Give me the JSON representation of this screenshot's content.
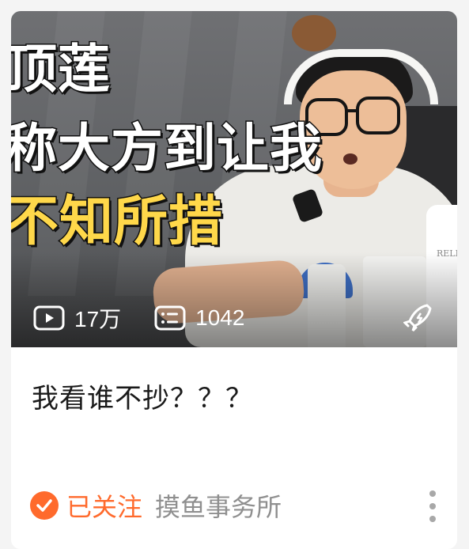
{
  "video_card": {
    "thumbnail": {
      "overlay_lines": [
        "顶莲",
        "称大方到让我",
        "不知所措"
      ],
      "overlay_colors": {
        "white_text": "#ffffff",
        "highlight_text": "#ffd84a"
      },
      "bottle_label": "RELL",
      "stats": {
        "play_icon": "play-icon",
        "play_count": "17万",
        "danmaku_icon": "danmaku-icon",
        "danmaku_count": "1042"
      },
      "promo_icon": "rocket-icon"
    },
    "title": "我看谁不抄？？？",
    "author": {
      "follow_icon": "check-circle-icon",
      "follow_status": "已关注",
      "name": "摸鱼事务所"
    },
    "more_icon": "more-vertical-icon",
    "colors": {
      "accent": "#ff6a2c",
      "muted": "#8f8f8f",
      "title": "#1a1a1a"
    }
  }
}
